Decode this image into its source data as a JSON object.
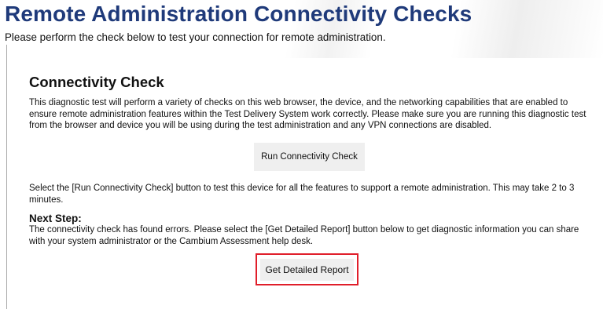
{
  "header": {
    "title": "Remote Administration Connectivity Checks",
    "subtitle": "Please perform the check below to test your connection for remote administration."
  },
  "connectivity_check": {
    "heading": "Connectivity Check",
    "description": "This diagnostic test will perform a variety of checks on this web browser, the device, and the networking capabilities that are enabled to ensure remote administration features within the Test Delivery System work correctly. Please make sure you are running this diagnostic test from the browser and device you will be using during the test administration and any VPN connections are disabled.",
    "run_button_label": "Run Connectivity Check",
    "instructions": "Select the [Run Connectivity Check] button to test this device for all the features to support a remote administration. This may take 2 to 3 minutes."
  },
  "next_step": {
    "heading": "Next Step:",
    "text": "The connectivity check has found errors. Please select the [Get Detailed Report] button below to get diagnostic information you can share with your system administrator or the Cambium Assessment help desk.",
    "report_button_label": "Get Detailed Report"
  },
  "colors": {
    "title": "#1f3a7a",
    "highlight": "#e01e2a",
    "button_bg": "#efefef"
  }
}
